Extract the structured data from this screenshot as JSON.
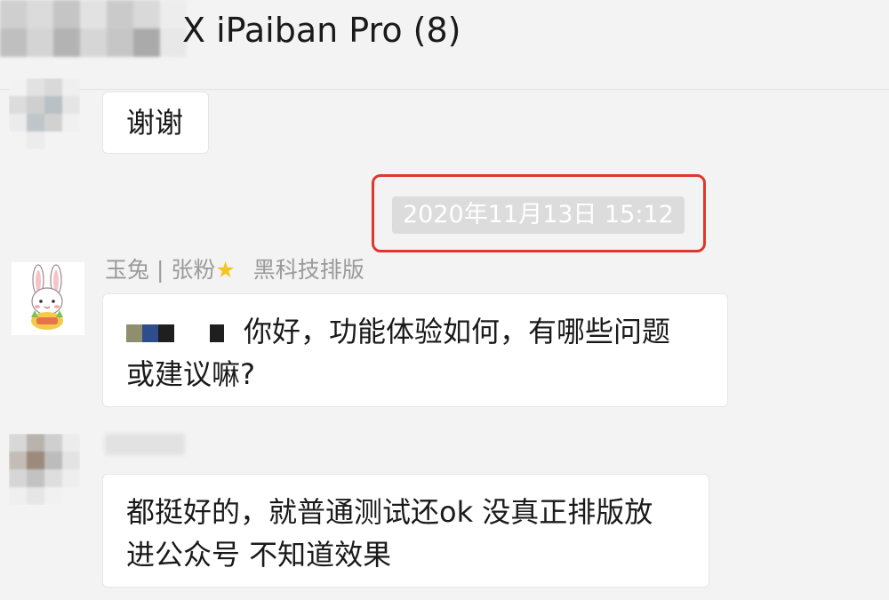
{
  "header": {
    "title": "X iPaiban Pro (8)"
  },
  "messages": [
    {
      "text": "谢谢"
    },
    {
      "timestamp": "2020年11月13日 15:12"
    },
    {
      "sender": {
        "name": "玉兔",
        "separator": "|",
        "tag": "张粉",
        "badge_icon": "star-icon",
        "group": "黑科技排版"
      },
      "text_line1": "你好，功能体验如何，有哪些问题",
      "text_line2": "或建议嘛?"
    },
    {
      "text_line1": "都挺好的，就普通测试还ok 没真正排版放",
      "text_line2": "进公众号 不知道效果"
    }
  ],
  "colors": {
    "highlight_border": "#e0362c",
    "timestamp_bg": "#dcdcdc",
    "bubble_bg": "#ffffff",
    "background": "#f3f3f3"
  }
}
